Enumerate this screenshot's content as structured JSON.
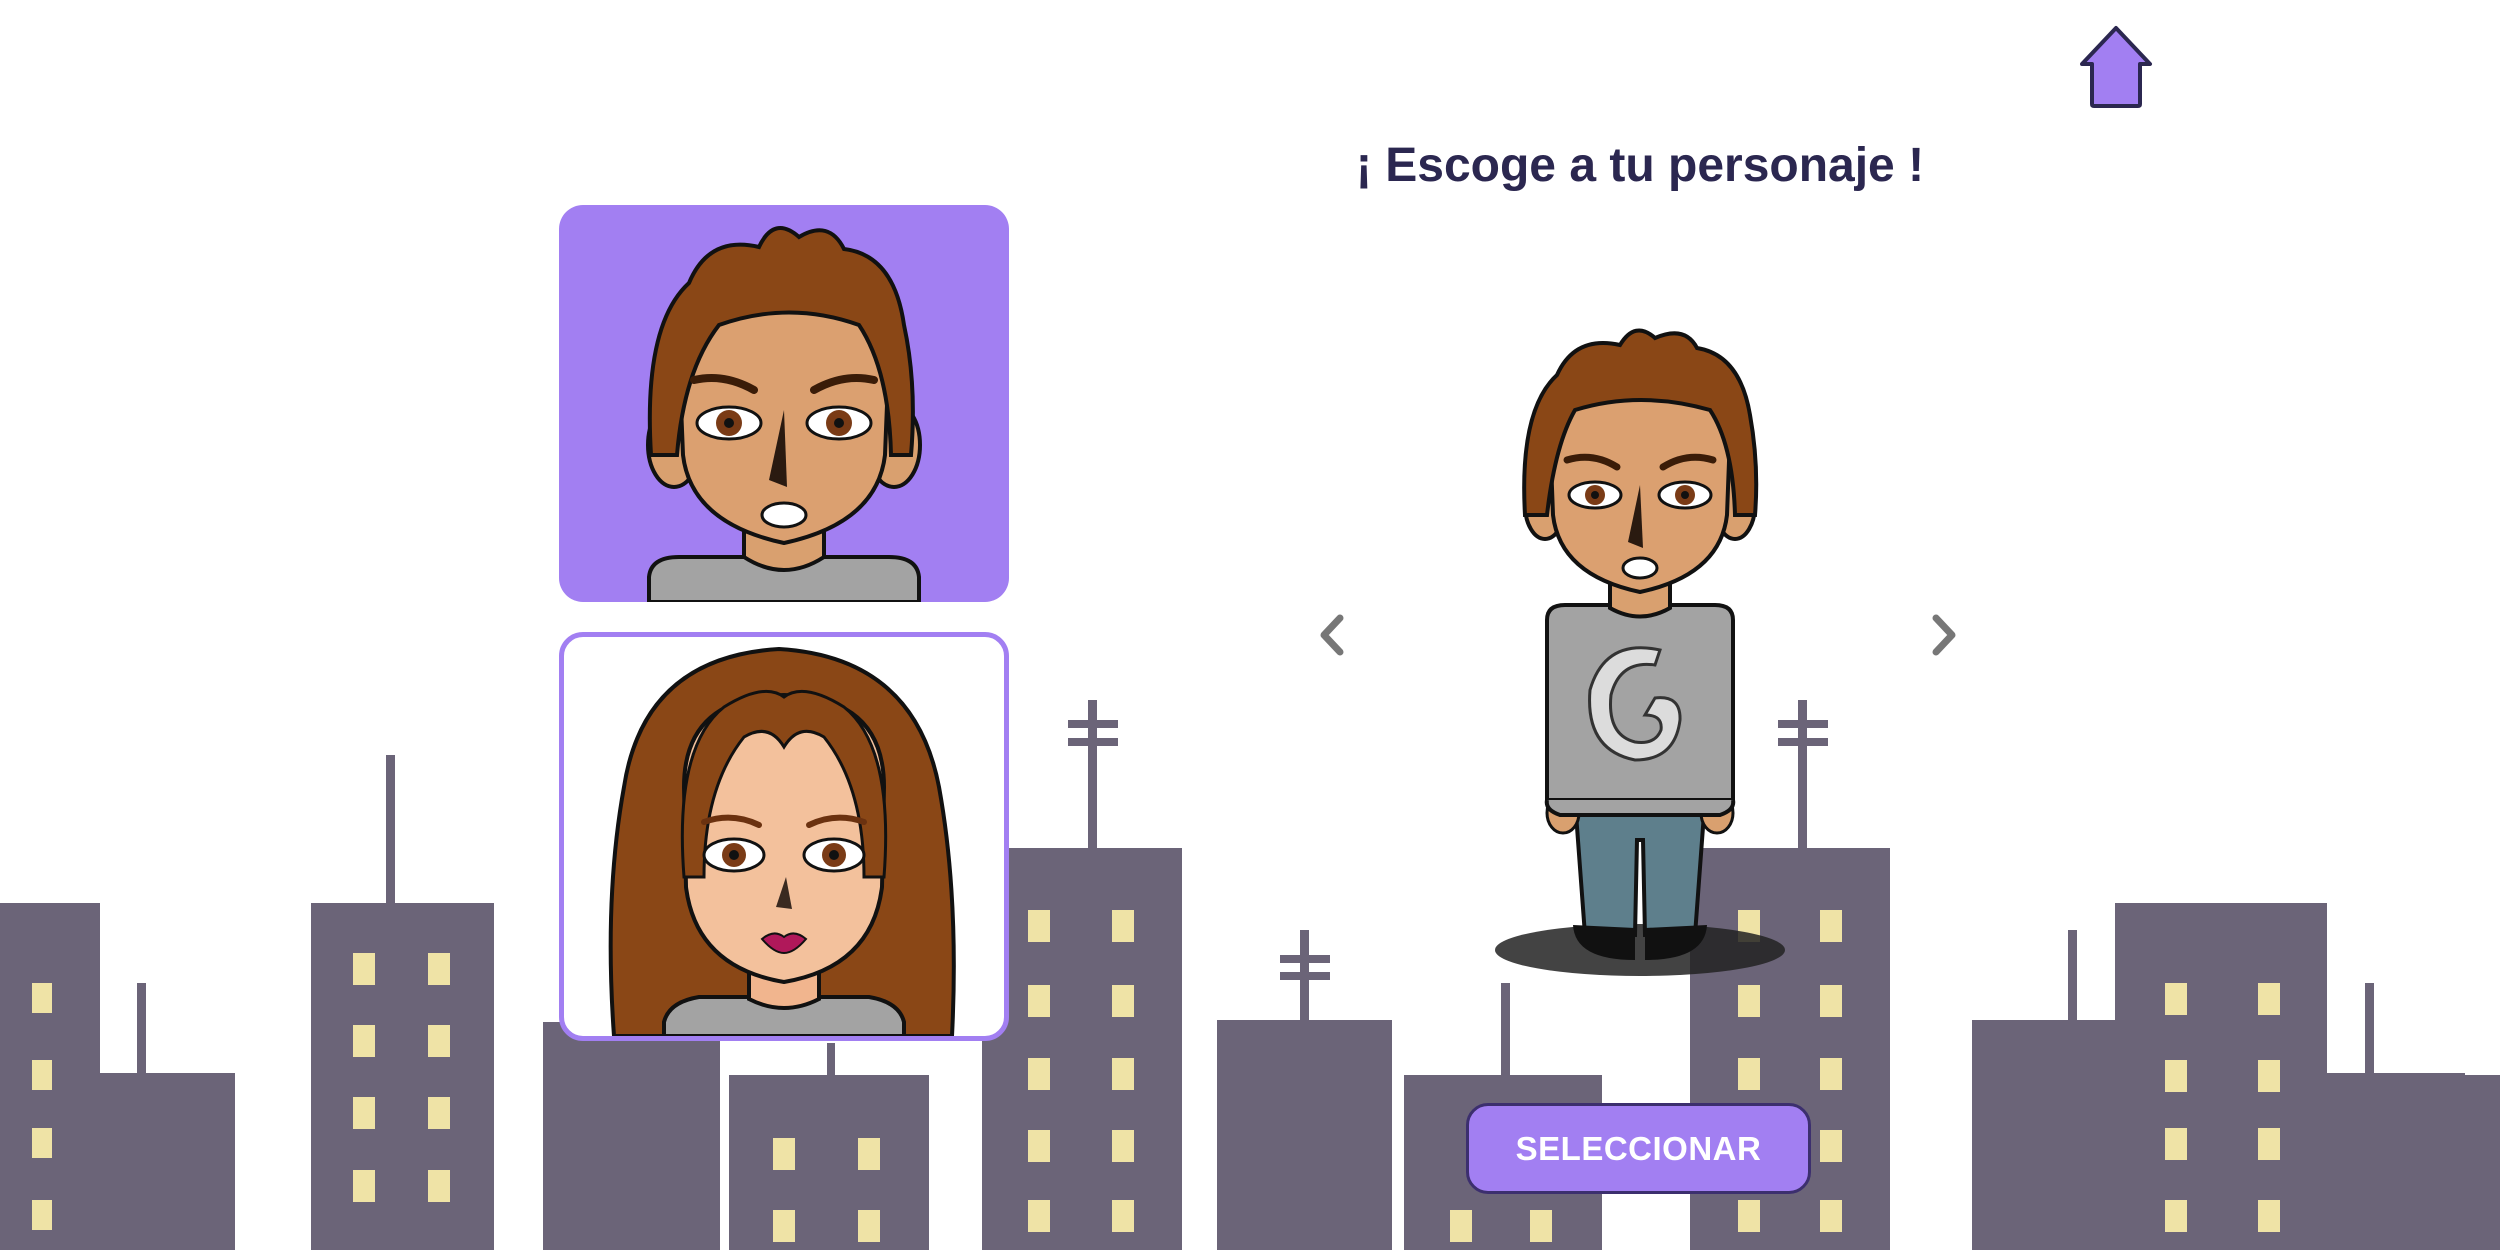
{
  "header": {
    "title": "¡ Escoge a tu personaje !",
    "home_icon": "house-icon"
  },
  "characters": [
    {
      "id": "boy",
      "selected": true
    },
    {
      "id": "girl",
      "selected": false
    }
  ],
  "carousel": {
    "prev_icon": "chevron-left-icon",
    "next_icon": "chevron-right-icon"
  },
  "actions": {
    "select_label": "SELECCIONAR"
  },
  "colors": {
    "accent": "#a27ff2",
    "title": "#2b2750",
    "buildings": "#6b6478",
    "windows": "#efe3a6"
  }
}
